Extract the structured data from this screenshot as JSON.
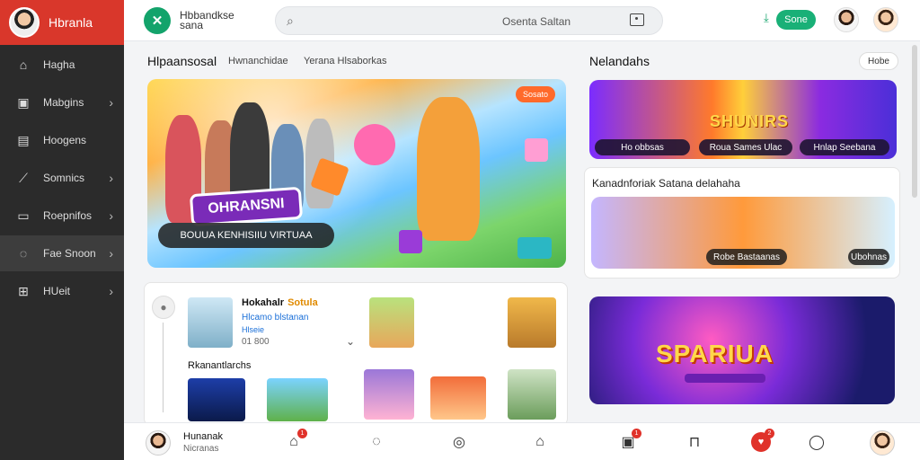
{
  "sidebar": {
    "brand": "Hbranla",
    "items": [
      {
        "label": "Hagha",
        "icon": "home-icon",
        "chevron": false
      },
      {
        "label": "Mabgins",
        "icon": "image-icon",
        "chevron": true
      },
      {
        "label": "Hoogens",
        "icon": "document-icon",
        "chevron": false
      },
      {
        "label": "Somnics",
        "icon": "trend-icon",
        "chevron": true
      },
      {
        "label": "Roepnifos",
        "icon": "folder-icon",
        "chevron": true
      },
      {
        "label": "Fae Snoon",
        "icon": "chat-icon",
        "chevron": true
      },
      {
        "label": "HUeit",
        "icon": "grid-icon",
        "chevron": true
      }
    ]
  },
  "header": {
    "logo_text": "Hbbandkse sana",
    "search_placeholder": "Osenta Saltan",
    "button_label": "Sone"
  },
  "main": {
    "section_title": "Hlpaansosal",
    "sub_tabs": [
      "Hwnanchidae",
      "Yerana Hlsaborkas"
    ],
    "hero": {
      "badge": "Sosato",
      "logo": "OHRANSNI",
      "caption": "BOUUA KENHISIIU VIRTUAA"
    },
    "feed": {
      "name": "Hokahalr",
      "tag": "Sotula",
      "line1": "Hlcamo blstanan",
      "line2": "Hlseie",
      "line3": "01 800",
      "row_label": "Rkanantlarchs"
    }
  },
  "right": {
    "title": "Nelandahs",
    "pill": "Hobe",
    "card1": {
      "word": "SHUNIRS",
      "chips": [
        "Ho obbsas",
        "Roua Sames Ulac",
        "Hnlap Seebana"
      ]
    },
    "card2": {
      "title": "Kanadnforiak Satana delahaha",
      "chips": [
        "Robe Bastaanas",
        "Ubohnas"
      ]
    },
    "card3": {
      "word": "SPARIUA"
    }
  },
  "bottomnav": {
    "name": "Hunanak",
    "sub": "Nicranas",
    "badge1": "1",
    "badge2": "1",
    "badge3": "2"
  }
}
